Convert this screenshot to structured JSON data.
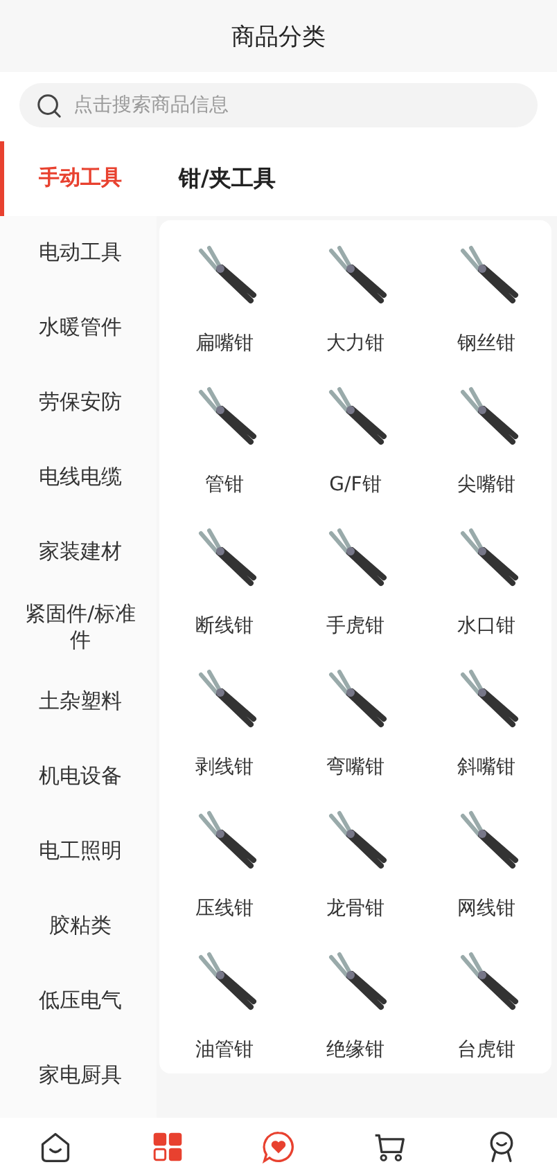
{
  "header": {
    "title": "商品分类"
  },
  "search": {
    "placeholder": "点击搜索商品信息"
  },
  "sidebar": {
    "items": [
      {
        "label": "手动工具",
        "selected": true
      },
      {
        "label": "电动工具",
        "selected": false
      },
      {
        "label": "水暖管件",
        "selected": false
      },
      {
        "label": "劳保安防",
        "selected": false
      },
      {
        "label": "电线电缆",
        "selected": false
      },
      {
        "label": "家装建材",
        "selected": false
      },
      {
        "label": "紧固件/标准件",
        "selected": false
      },
      {
        "label": "土杂塑料",
        "selected": false
      },
      {
        "label": "机电设备",
        "selected": false
      },
      {
        "label": "电工照明",
        "selected": false
      },
      {
        "label": "胶粘类",
        "selected": false
      },
      {
        "label": "低压电气",
        "selected": false
      },
      {
        "label": "家电厨具",
        "selected": false
      }
    ]
  },
  "section": {
    "title": "钳/夹工具",
    "products": [
      {
        "label": "扁嘴钳"
      },
      {
        "label": "大力钳"
      },
      {
        "label": "钢丝钳"
      },
      {
        "label": "管钳"
      },
      {
        "label": "G/F钳"
      },
      {
        "label": "尖嘴钳"
      },
      {
        "label": "断线钳"
      },
      {
        "label": "手虎钳"
      },
      {
        "label": "水口钳"
      },
      {
        "label": "剥线钳"
      },
      {
        "label": "弯嘴钳"
      },
      {
        "label": "斜嘴钳"
      },
      {
        "label": "压线钳"
      },
      {
        "label": "龙骨钳"
      },
      {
        "label": "网线钳"
      },
      {
        "label": "油管钳"
      },
      {
        "label": "绝缘钳"
      },
      {
        "label": "台虎钳"
      }
    ]
  },
  "tab_bar": {
    "items": [
      {
        "kind": "home",
        "selected": false
      },
      {
        "kind": "category",
        "selected": true
      },
      {
        "kind": "message",
        "selected": false
      },
      {
        "kind": "cart",
        "selected": false
      },
      {
        "kind": "profile",
        "selected": false
      }
    ]
  }
}
